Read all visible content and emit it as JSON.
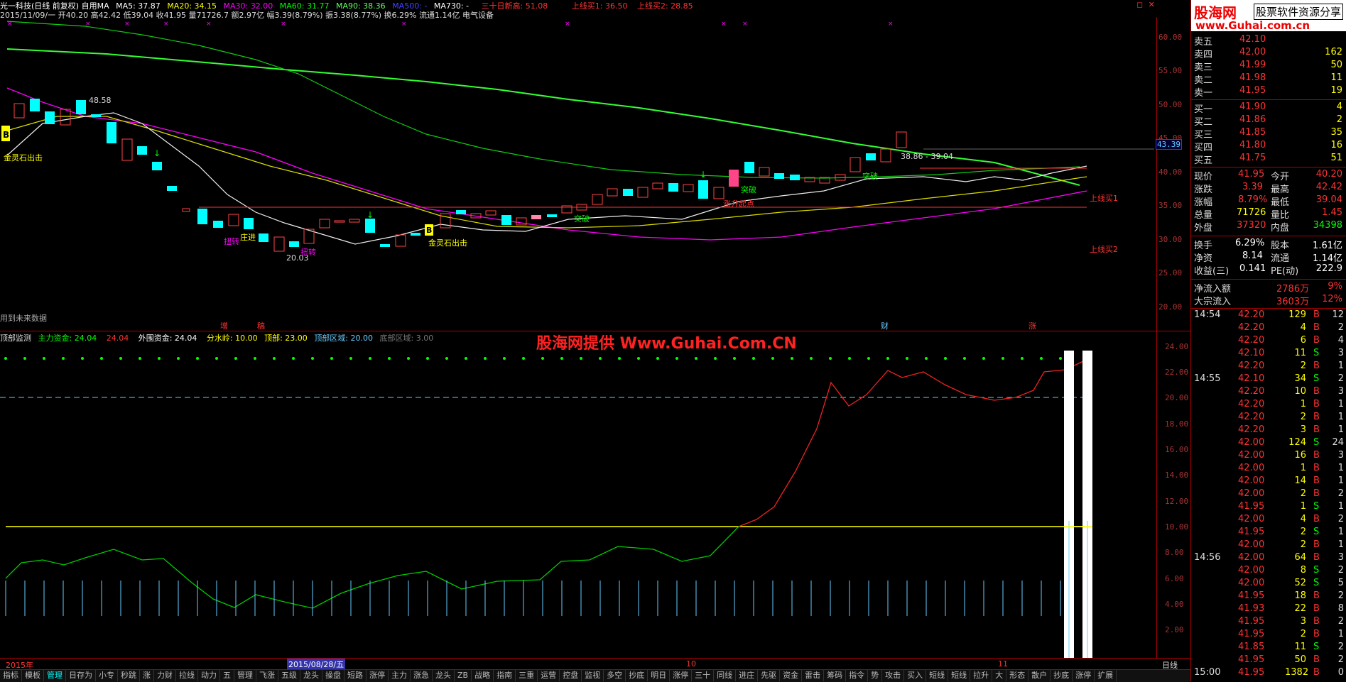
{
  "header": {
    "stock": "光一科技(日线 前复权) 自用MA",
    "ma5": "MA5: 37.87",
    "ma20": "MA20: 34.15",
    "ma30": "MA30: 32.00",
    "ma60": "MA60: 31.77",
    "ma90": "MA90: 38.36",
    "ma500": "MA500: -",
    "ma730": "MA730: -",
    "high30": "三十日新高: 51.08",
    "line1": "上线买1: 36.50",
    "line2": "上线买2: 28.85"
  },
  "info_line": "2015/11/09/一 开40.20 高42.42 低39.04 收41.95 量71726.7 额2.97亿 幅3.39(8.79%) 振3.38(8.77%) 换6.29% 流通1.14亿 电气设备",
  "window_controls": [
    "◻",
    "✕"
  ],
  "logo": {
    "brand": "股海网",
    "slogan": "股票软件资源分享",
    "url": "www.Guhai.com.cn"
  },
  "watermark": "股海网提供 Www.Guhai.Com.CN",
  "price_axis": [
    "60.00",
    "55.00",
    "50.00",
    "45.00",
    "40.00",
    "35.00",
    "30.00",
    "25.00",
    "20.00"
  ],
  "price_box": "43.39",
  "annotations": {
    "b1": "B",
    "b1_text": "金灵石出击",
    "b2": "B",
    "b2_text": "金灵石出击",
    "high": "48.58",
    "low": "20.03",
    "twist1": "扭转",
    "twist2": "扭转",
    "zhuangjin": "庄进",
    "breakthrough1": "突破",
    "breakthrough2": "突破",
    "breakthrough3": "突破",
    "rise_start": "涨升起点",
    "range": "38.86 - 39.04",
    "line_buy1": "上线买1",
    "line_buy2": "上线买2",
    "future_data": "用到未来数据",
    "event_zeng": "增",
    "event_gao": "稿",
    "event_cai": "财",
    "event_zhang": "涨"
  },
  "indicator": {
    "name": "顶部监测",
    "main_fund": "主力资金: 24.04",
    "main_fund2": "24.04",
    "outer_fund": "外围资金: 24.04",
    "watershed": "分水岭: 10.00",
    "top": "顶部: 23.00",
    "top_zone": "顶部区域: 20.00",
    "bottom_zone": "底部区域: 3.00"
  },
  "indicator_axis": [
    "24.00",
    "22.00",
    "20.00",
    "18.00",
    "16.00",
    "14.00",
    "12.00",
    "10.00",
    "8.00",
    "6.00",
    "4.00",
    "2.00"
  ],
  "time_axis": {
    "y2015": "2015年",
    "cursor": "2015/08/28/五",
    "m10": "10",
    "m11": "11",
    "period": "日线"
  },
  "bottom_tabs": [
    "指标",
    "模板",
    "管理",
    "日存为",
    "小专",
    "秒跳",
    "涨",
    "力财",
    "拉线",
    "动力",
    "五",
    "管理",
    "飞涨",
    "五级",
    "龙头",
    "操盘",
    "短路",
    "涨停",
    "主力",
    "涨急",
    "龙头",
    "ZB",
    "战略",
    "指南",
    "三重",
    "运营",
    "控盘",
    "监视",
    "多空",
    "抄底",
    "明日",
    "涨停",
    "三十",
    "同线",
    "进庄",
    "先驱",
    "资金",
    "雷击",
    "筹码",
    "指令",
    "势",
    "攻击",
    "买入",
    "短线",
    "短线",
    "拉升",
    "大",
    "形态",
    "散户",
    "抄底",
    "涨停",
    "扩展"
  ],
  "active_tab": 2,
  "orderbook": {
    "sells": [
      {
        "label": "卖五",
        "price": "42.10",
        "vol": ""
      },
      {
        "label": "卖四",
        "price": "42.00",
        "vol": "162"
      },
      {
        "label": "卖三",
        "price": "41.99",
        "vol": "50"
      },
      {
        "label": "卖二",
        "price": "41.98",
        "vol": "11"
      },
      {
        "label": "卖一",
        "price": "41.95",
        "vol": "19"
      }
    ],
    "buys": [
      {
        "label": "买一",
        "price": "41.90",
        "vol": "4"
      },
      {
        "label": "买二",
        "price": "41.86",
        "vol": "2"
      },
      {
        "label": "买三",
        "price": "41.85",
        "vol": "35"
      },
      {
        "label": "买四",
        "price": "41.80",
        "vol": "16"
      },
      {
        "label": "买五",
        "price": "41.75",
        "vol": "51"
      }
    ]
  },
  "quote": [
    {
      "l1": "现价",
      "v1": "41.95",
      "l2": "今开",
      "v2": "40.20"
    },
    {
      "l1": "涨跌",
      "v1": "3.39",
      "l2": "最高",
      "v2": "42.42"
    },
    {
      "l1": "涨幅",
      "v1": "8.79%",
      "l2": "最低",
      "v2": "39.04"
    },
    {
      "l1": "总量",
      "v1": "71726",
      "l2": "量比",
      "v2": "1.45"
    },
    {
      "l1": "外盘",
      "v1": "37320",
      "l2": "内盘",
      "v2": "34398"
    }
  ],
  "stats": [
    {
      "l1": "换手",
      "v1": "6.29%",
      "l2": "股本",
      "v2": "1.61亿"
    },
    {
      "l1": "净资",
      "v1": "8.14",
      "l2": "流通",
      "v2": "1.14亿"
    },
    {
      "l1": "收益(三)",
      "v1": "0.141",
      "l2": "PE(动)",
      "v2": "222.9"
    }
  ],
  "flows": [
    {
      "label": "净流入额",
      "v": "2786万",
      "p": "9%"
    },
    {
      "label": "大宗流入",
      "v": "3603万",
      "p": "12%"
    }
  ],
  "ticks": [
    {
      "t": "14:54",
      "p": "42.20",
      "v": "129",
      "s": "B",
      "n": "12"
    },
    {
      "t": "",
      "p": "42.20",
      "v": "4",
      "s": "B",
      "n": "2"
    },
    {
      "t": "",
      "p": "42.20",
      "v": "6",
      "s": "B",
      "n": "4"
    },
    {
      "t": "",
      "p": "42.10",
      "v": "11",
      "s": "S",
      "n": "3"
    },
    {
      "t": "",
      "p": "42.20",
      "v": "2",
      "s": "B",
      "n": "1"
    },
    {
      "t": "14:55",
      "p": "42.10",
      "v": "34",
      "s": "S",
      "n": "2"
    },
    {
      "t": "",
      "p": "42.20",
      "v": "10",
      "s": "B",
      "n": "3"
    },
    {
      "t": "",
      "p": "42.20",
      "v": "1",
      "s": "B",
      "n": "1"
    },
    {
      "t": "",
      "p": "42.20",
      "v": "2",
      "s": "B",
      "n": "1"
    },
    {
      "t": "",
      "p": "42.20",
      "v": "3",
      "s": "B",
      "n": "1"
    },
    {
      "t": "",
      "p": "42.00",
      "v": "124",
      "s": "S",
      "n": "24"
    },
    {
      "t": "",
      "p": "42.00",
      "v": "16",
      "s": "B",
      "n": "3"
    },
    {
      "t": "",
      "p": "42.00",
      "v": "1",
      "s": "B",
      "n": "1"
    },
    {
      "t": "",
      "p": "42.00",
      "v": "14",
      "s": "B",
      "n": "1"
    },
    {
      "t": "",
      "p": "42.00",
      "v": "2",
      "s": "B",
      "n": "2"
    },
    {
      "t": "",
      "p": "41.95",
      "v": "1",
      "s": "S",
      "n": "1"
    },
    {
      "t": "",
      "p": "42.00",
      "v": "4",
      "s": "B",
      "n": "2"
    },
    {
      "t": "",
      "p": "41.95",
      "v": "2",
      "s": "S",
      "n": "1"
    },
    {
      "t": "",
      "p": "42.00",
      "v": "2",
      "s": "B",
      "n": "1"
    },
    {
      "t": "14:56",
      "p": "42.00",
      "v": "64",
      "s": "B",
      "n": "3"
    },
    {
      "t": "",
      "p": "42.00",
      "v": "8",
      "s": "S",
      "n": "2"
    },
    {
      "t": "",
      "p": "42.00",
      "v": "52",
      "s": "S",
      "n": "5"
    },
    {
      "t": "",
      "p": "41.95",
      "v": "18",
      "s": "B",
      "n": "2"
    },
    {
      "t": "",
      "p": "41.93",
      "v": "22",
      "s": "B",
      "n": "8"
    },
    {
      "t": "",
      "p": "41.95",
      "v": "3",
      "s": "B",
      "n": "2"
    },
    {
      "t": "",
      "p": "41.95",
      "v": "2",
      "s": "B",
      "n": "1"
    },
    {
      "t": "",
      "p": "41.85",
      "v": "11",
      "s": "S",
      "n": "2"
    },
    {
      "t": "",
      "p": "41.95",
      "v": "50",
      "s": "B",
      "n": "2"
    },
    {
      "t": "15:00",
      "p": "41.95",
      "v": "1382",
      "s": "B",
      "n": "0"
    }
  ]
}
